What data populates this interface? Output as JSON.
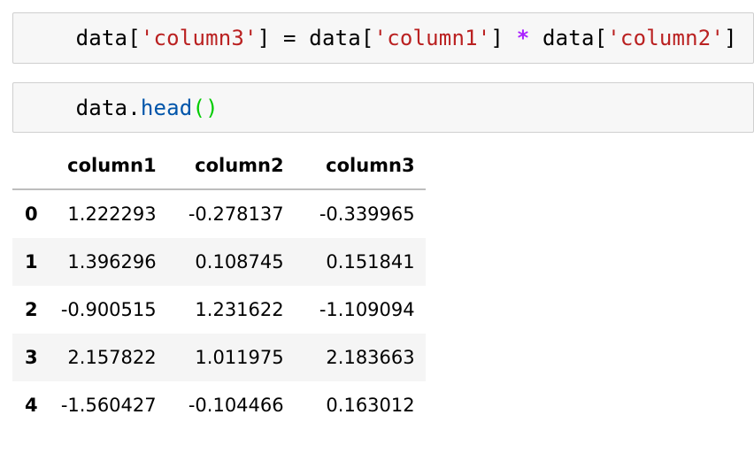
{
  "cells": [
    {
      "tokens": [
        {
          "text": "data[",
          "kind": "plain"
        },
        {
          "text": "'column3'",
          "kind": "str"
        },
        {
          "text": "] = data[",
          "kind": "plain"
        },
        {
          "text": "'column1'",
          "kind": "str"
        },
        {
          "text": "] ",
          "kind": "plain"
        },
        {
          "text": "*",
          "kind": "op"
        },
        {
          "text": " data[",
          "kind": "plain"
        },
        {
          "text": "'column2'",
          "kind": "str"
        },
        {
          "text": "]",
          "kind": "plain"
        }
      ]
    },
    {
      "tokens": [
        {
          "text": "data.",
          "kind": "plain"
        },
        {
          "text": "head",
          "kind": "fn"
        },
        {
          "text": "()",
          "kind": "paren"
        }
      ]
    }
  ],
  "table": {
    "index_header": "",
    "columns": [
      "column1",
      "column2",
      "column3"
    ],
    "rows": [
      {
        "index": "0",
        "values": [
          "1.222293",
          "-0.278137",
          "-0.339965"
        ]
      },
      {
        "index": "1",
        "values": [
          "1.396296",
          "0.108745",
          "0.151841"
        ]
      },
      {
        "index": "2",
        "values": [
          "-0.900515",
          "1.231622",
          "-1.109094"
        ]
      },
      {
        "index": "3",
        "values": [
          "2.157822",
          "1.011975",
          "2.183663"
        ]
      },
      {
        "index": "4",
        "values": [
          "-1.560427",
          "-0.104466",
          "0.163012"
        ]
      }
    ]
  },
  "colors": {
    "string": "#ba2121",
    "operator": "#aa22ff",
    "function": "#0055aa",
    "paren": "#00cc00",
    "cell_background": "#f7f7f7",
    "cell_border": "#cfcfcf",
    "striped_row": "#f5f5f5"
  }
}
